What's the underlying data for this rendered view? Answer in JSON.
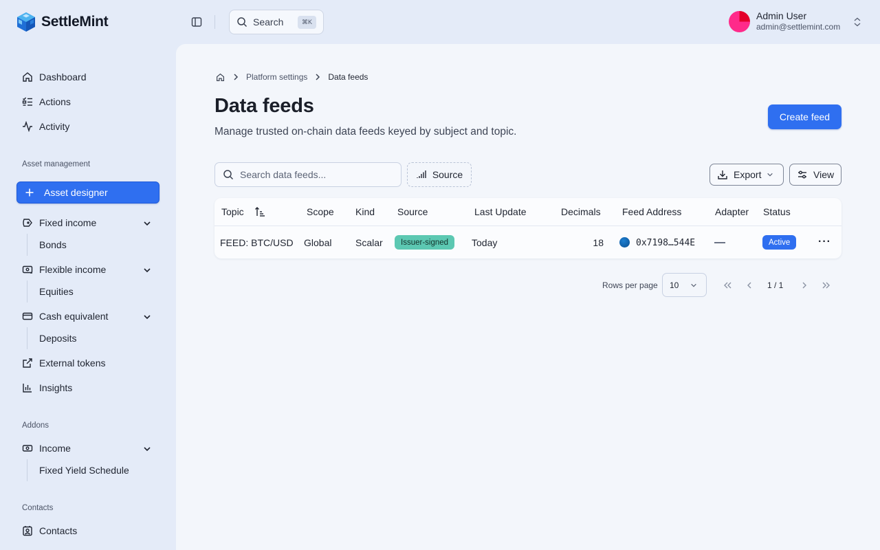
{
  "app": {
    "brand": "SettleMint",
    "search_label": "Search",
    "search_shortcut": "⌘K"
  },
  "user": {
    "name": "Admin User",
    "email": "admin@settlemint.com"
  },
  "sidebar": {
    "primary": [
      {
        "label": "Dashboard",
        "icon": "home-icon"
      },
      {
        "label": "Actions",
        "icon": "list-check-icon"
      },
      {
        "label": "Activity",
        "icon": "activity-icon"
      }
    ],
    "asset_management_label": "Asset management",
    "asset_designer_label": "Asset designer",
    "fixed_income": {
      "label": "Fixed income",
      "sub": "Bonds"
    },
    "flexible_income": {
      "label": "Flexible income",
      "sub": "Equities"
    },
    "cash_equivalent": {
      "label": "Cash equivalent",
      "sub": "Deposits"
    },
    "external_tokens_label": "External tokens",
    "insights_label": "Insights",
    "addons_label": "Addons",
    "income": {
      "label": "Income",
      "sub": "Fixed Yield Schedule"
    },
    "contacts_section_label": "Contacts",
    "contacts_label": "Contacts"
  },
  "breadcrumb": {
    "parent": "Platform settings",
    "current": "Data feeds"
  },
  "page": {
    "title": "Data feeds",
    "subtitle": "Manage trusted on-chain data feeds keyed by subject and topic.",
    "create_label": "Create feed"
  },
  "toolbar": {
    "search_placeholder": "Search data feeds...",
    "source_filter_label": "Source",
    "export_label": "Export",
    "view_label": "View"
  },
  "table": {
    "columns": [
      "Topic",
      "Scope",
      "Kind",
      "Source",
      "Last Update",
      "Decimals",
      "Feed Address",
      "Adapter",
      "Status"
    ],
    "rows": [
      {
        "topic": "FEED: BTC/USD",
        "scope": "Global",
        "kind": "Scalar",
        "source": "Issuer-signed",
        "last_update": "Today",
        "decimals": "18",
        "feed_address": "0x7198…544E",
        "adapter": "—",
        "status": "Active"
      }
    ]
  },
  "pagination": {
    "rows_per_page_label": "Rows per page",
    "rows_per_page": "10",
    "page_indicator": "1 / 1"
  },
  "colors": {
    "accent": "#2f6ff0",
    "source_badge": "#5cc8b2",
    "sidebar_bg": "#e4ebf8",
    "main_bg": "#f3f6fb"
  }
}
